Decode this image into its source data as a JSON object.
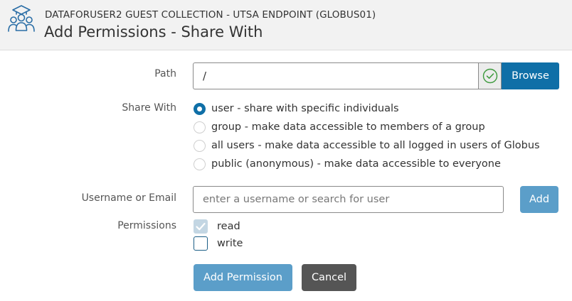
{
  "header": {
    "icon": "users-group-icon",
    "subtitle": "DATAFORUSER2 GUEST COLLECTION - UTSA ENDPOINT (GLOBUS01)",
    "title": "Add Permissions - Share With"
  },
  "path": {
    "label": "Path",
    "value": "/",
    "status_icon": "check-circle-icon",
    "browse_label": "Browse"
  },
  "share_with": {
    "label": "Share With",
    "selected": "user",
    "options": [
      {
        "id": "user",
        "label": "user - share with specific individuals"
      },
      {
        "id": "group",
        "label": "group - make data accessible to members of a group"
      },
      {
        "id": "all-users",
        "label": "all users - make data accessible to all logged in users of Globus"
      },
      {
        "id": "public",
        "label": "public (anonymous) - make data accessible to everyone"
      }
    ]
  },
  "user_lookup": {
    "label": "Username or Email",
    "placeholder": "enter a username or search for user",
    "value": "",
    "add_label": "Add"
  },
  "permissions": {
    "label": "Permissions",
    "items": [
      {
        "id": "read",
        "label": "read",
        "checked": true,
        "disabled": true
      },
      {
        "id": "write",
        "label": "write",
        "checked": false,
        "disabled": false
      }
    ]
  },
  "actions": {
    "submit_label": "Add Permission",
    "cancel_label": "Cancel"
  },
  "colors": {
    "primary": "#0f6fa7",
    "primary_light": "#5b9ec9",
    "success": "#3c9a3c",
    "secondary": "#555555",
    "header_bg": "#f2f2f2"
  }
}
